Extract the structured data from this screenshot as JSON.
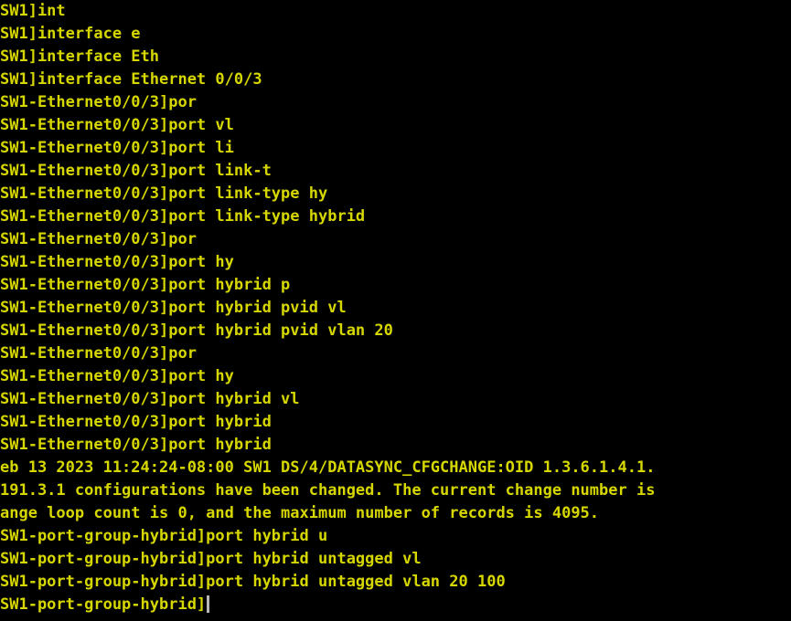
{
  "terminal": {
    "title": "SW1 console session",
    "foreground_color": "#d7d700",
    "background_color": "#000000",
    "cursor_color": "#b8b8b8",
    "columns": 70,
    "rows": 27,
    "lines": [
      {
        "id": "line-01",
        "type": "prompt",
        "text": "SW1]int"
      },
      {
        "id": "line-02",
        "type": "prompt",
        "text": "SW1]interface e"
      },
      {
        "id": "line-03",
        "type": "prompt",
        "text": "SW1]interface Eth"
      },
      {
        "id": "line-04",
        "type": "prompt",
        "text": "SW1]interface Ethernet 0/0/3"
      },
      {
        "id": "line-05",
        "type": "prompt",
        "text": "SW1-Ethernet0/0/3]por"
      },
      {
        "id": "line-06",
        "type": "prompt",
        "text": "SW1-Ethernet0/0/3]port vl"
      },
      {
        "id": "line-07",
        "type": "prompt",
        "text": "SW1-Ethernet0/0/3]port li"
      },
      {
        "id": "line-08",
        "type": "prompt",
        "text": "SW1-Ethernet0/0/3]port link-t"
      },
      {
        "id": "line-09",
        "type": "prompt",
        "text": "SW1-Ethernet0/0/3]port link-type hy"
      },
      {
        "id": "line-10",
        "type": "prompt",
        "text": "SW1-Ethernet0/0/3]port link-type hybrid"
      },
      {
        "id": "line-11",
        "type": "prompt",
        "text": "SW1-Ethernet0/0/3]por"
      },
      {
        "id": "line-12",
        "type": "prompt",
        "text": "SW1-Ethernet0/0/3]port hy"
      },
      {
        "id": "line-13",
        "type": "prompt",
        "text": "SW1-Ethernet0/0/3]port hybrid p"
      },
      {
        "id": "line-14",
        "type": "prompt",
        "text": "SW1-Ethernet0/0/3]port hybrid pvid vl"
      },
      {
        "id": "line-15",
        "type": "prompt",
        "text": "SW1-Ethernet0/0/3]port hybrid pvid vlan 20"
      },
      {
        "id": "line-16",
        "type": "prompt",
        "text": "SW1-Ethernet0/0/3]por"
      },
      {
        "id": "line-17",
        "type": "prompt",
        "text": "SW1-Ethernet0/0/3]port hy"
      },
      {
        "id": "line-18",
        "type": "prompt",
        "text": "SW1-Ethernet0/0/3]port hybrid vl"
      },
      {
        "id": "line-19",
        "type": "prompt",
        "text": "SW1-Ethernet0/0/3]port hybrid"
      },
      {
        "id": "line-20",
        "type": "prompt",
        "text": "SW1-Ethernet0/0/3]port hybrid"
      },
      {
        "id": "line-21",
        "type": "log",
        "text": "eb 13 2023 11:24:24-08:00 SW1 DS/4/DATASYNC_CFGCHANGE:OID 1.3.6.1.4.1."
      },
      {
        "id": "line-22",
        "type": "log",
        "text": "191.3.1 configurations have been changed. The current change number is"
      },
      {
        "id": "line-23",
        "type": "log",
        "text": "ange loop count is 0, and the maximum number of records is 4095."
      },
      {
        "id": "line-24",
        "type": "prompt",
        "text": "SW1-port-group-hybrid]port hybrid u"
      },
      {
        "id": "line-25",
        "type": "prompt",
        "text": "SW1-port-group-hybrid]port hybrid untagged vl"
      },
      {
        "id": "line-26",
        "type": "prompt",
        "text": "SW1-port-group-hybrid]port hybrid untagged vlan 20 100"
      },
      {
        "id": "line-27",
        "type": "prompt_active",
        "text": "SW1-port-group-hybrid]"
      }
    ]
  }
}
